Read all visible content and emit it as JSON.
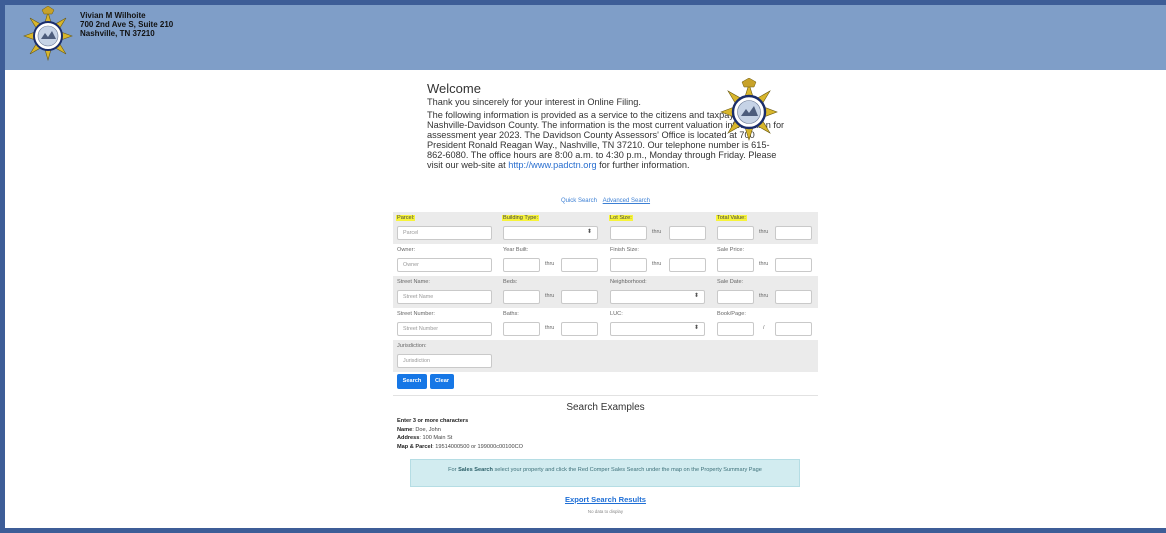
{
  "header": {
    "name": "Vivian M Wilhoite",
    "address_line1": "700 2nd Ave S, Suite 210",
    "address_line2": "Nashville, TN 37210",
    "seal_icon": "metro-nashville-seal-icon"
  },
  "welcome": {
    "title": "Welcome",
    "p1": "Thank you sincerely for your interest in Online Filing.",
    "p2": "The following information is provided as a service to the citizens and taxpayers of Nashville-Davidson County. The information is the most current valuation information for assessment year 2023. The Davidson County Assessors' Office is located at 700 President Ronald Reagan Way., Nashville, TN 37210. Our telephone number is 615-862-6080. The office hours are 8:00 a.m. to 4:30 p.m., Monday through Friday. Please visit our web-site at",
    "link": "http://www.padctn.org",
    "p2_tail": "for further information."
  },
  "search_links": {
    "quick": "Quick Search",
    "advanced": "Advanced Search"
  },
  "form": {
    "parcel_label": "Parcel:",
    "parcel_placeholder": "Parcel",
    "building_type_label": "Building Type:",
    "lot_size_label": "Lot Size:",
    "total_value_label": "Total Value:",
    "owner_label": "Owner:",
    "owner_placeholder": "Owner",
    "year_built_label": "Year Built:",
    "finish_size_label": "Finish Size:",
    "sale_price_label": "Sale Price:",
    "street_name_label": "Street Name:",
    "street_name_placeholder": "Street Name",
    "beds_label": "Beds:",
    "neighborhood_label": "Neighborhood:",
    "sale_date_label": "Sale Date:",
    "street_number_label": "Street Number:",
    "street_number_placeholder": "Street Number",
    "baths_label": "Baths:",
    "luc_label": "LUC:",
    "book_page_label": "Book/Page:",
    "book_page_sep": "/",
    "jurisdiction_label": "Jurisdiction:",
    "jurisdiction_placeholder": "Jurisdiction",
    "thru": "thru",
    "caret": "⬍",
    "highlight_color": "#f7f43a"
  },
  "buttons": {
    "search": "Search",
    "clear": "Clear"
  },
  "examples": {
    "title": "Search Examples",
    "hint": "Enter 3 or more characters",
    "name_label": "Name",
    "name_value": ": Doe, John",
    "address_label": "Address",
    "address_value": ": 100 Main St",
    "map_parcel_label": "Map & Parcel",
    "map_parcel_value": ": 19514000500 or 199000c00100CO"
  },
  "info_box": {
    "prefix": "For",
    "bold": "Sales Search",
    "text": "select your property and click the Red Comper Sales Search under the map on the Property Summary Page"
  },
  "export_link": "Export Search Results",
  "no_data": "No data to display"
}
